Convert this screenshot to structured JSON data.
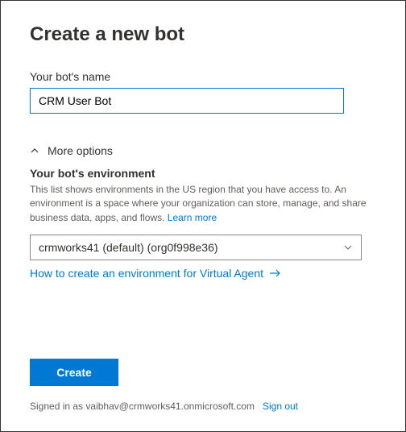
{
  "title": "Create a new bot",
  "name_field": {
    "label": "Your bot's name",
    "value": "CRM User Bot"
  },
  "more_options": {
    "label": "More options"
  },
  "environment": {
    "label": "Your bot's environment",
    "description_part1": "This list shows environments in the US region that you have access to. An environment is a space where your organization can store, manage, and share business data, apps, and flows. ",
    "learn_more_label": "Learn more",
    "selected": "crmworks41 (default) (org0f998e36)",
    "how_to_link": "How to create an environment for Virtual Agent"
  },
  "actions": {
    "create_label": "Create"
  },
  "footer": {
    "signed_in_prefix": "Signed in as ",
    "user_email": "vaibhav@crmworks41.onmicrosoft.com",
    "sign_out_label": "Sign out"
  }
}
